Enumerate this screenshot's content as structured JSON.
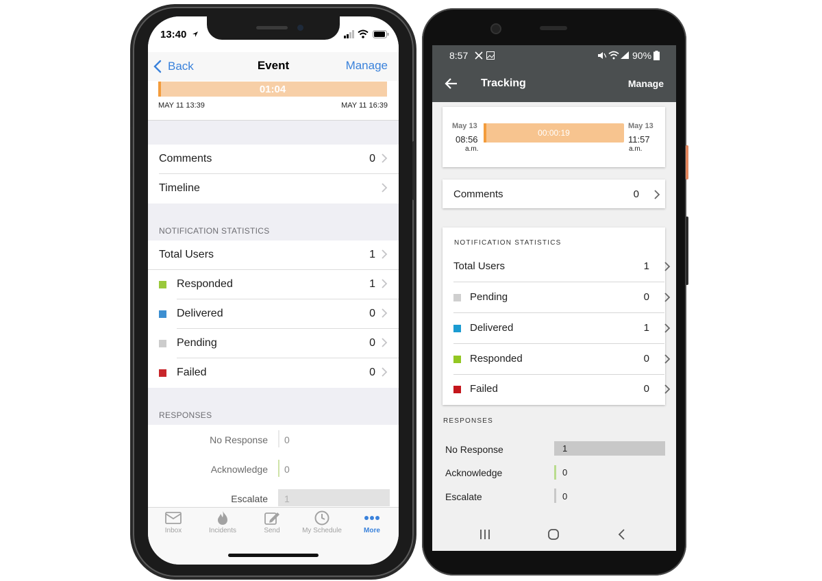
{
  "iphone": {
    "status_time": "13:40",
    "nav": {
      "back_label": "Back",
      "title": "Event",
      "manage_label": "Manage"
    },
    "timer": {
      "value": "01:04",
      "start": "MAY 11 13:39",
      "end": "MAY 11 16:39",
      "color": "#f7cfa7",
      "accent": "#f39c3c"
    },
    "rows": {
      "comments_label": "Comments",
      "comments_value": "0",
      "timeline_label": "Timeline"
    },
    "notification_header": "NOTIFICATION STATISTICS",
    "stats": [
      {
        "label": "Total Users",
        "value": "1",
        "color": ""
      },
      {
        "label": "Responded",
        "value": "1",
        "color": "#9ac93b"
      },
      {
        "label": "Delivered",
        "value": "0",
        "color": "#3d8fd1"
      },
      {
        "label": "Pending",
        "value": "0",
        "color": "#cccccc"
      },
      {
        "label": "Failed",
        "value": "0",
        "color": "#c8262b"
      }
    ],
    "responses_header": "RESPONSES",
    "responses": [
      {
        "label": "No Response",
        "value": "0",
        "color": "#e8e8e8"
      },
      {
        "label": "Acknowledge",
        "value": "0",
        "color": "#cfe3a8"
      },
      {
        "label": "Escalate",
        "value": "1",
        "color": "#e2e2e2"
      }
    ],
    "tabs": [
      {
        "label": "Inbox",
        "icon": "inbox-icon",
        "active": false
      },
      {
        "label": "Incidents",
        "icon": "flame-icon",
        "active": false
      },
      {
        "label": "Send",
        "icon": "compose-icon",
        "active": false
      },
      {
        "label": "My Schedule",
        "icon": "clock-icon",
        "active": false
      },
      {
        "label": "More",
        "icon": "more-dots-icon",
        "active": true
      }
    ]
  },
  "android": {
    "status_time": "8:57",
    "battery": "90%",
    "appbar": {
      "title": "Tracking",
      "manage_label": "Manage"
    },
    "timer": {
      "value": "00:00:19",
      "start_date": "May 13",
      "start_time": "08:56",
      "start_ampm": "a.m.",
      "end_date": "May 13",
      "end_time": "11:57",
      "end_ampm": "a.m.",
      "color": "#f7c48f",
      "accent": "#f39c3c"
    },
    "comments": {
      "label": "Comments",
      "value": "0"
    },
    "notification_header": "NOTIFICATION STATISTICS",
    "stats": [
      {
        "label": "Total Users",
        "value": "1",
        "color": ""
      },
      {
        "label": "Pending",
        "value": "0",
        "color": "#cfcfcf"
      },
      {
        "label": "Delivered",
        "value": "1",
        "color": "#1b9bd1"
      },
      {
        "label": "Responded",
        "value": "0",
        "color": "#93c722"
      },
      {
        "label": "Failed",
        "value": "0",
        "color": "#c4161c"
      }
    ],
    "responses_header": "RESPONSES",
    "responses": [
      {
        "label": "No Response",
        "value": "1",
        "color": "#c8c8c8"
      },
      {
        "label": "Acknowledge",
        "value": "0",
        "color": "#b9dc8e"
      },
      {
        "label": "Escalate",
        "value": "0",
        "color": "#c8c8c8"
      }
    ]
  }
}
